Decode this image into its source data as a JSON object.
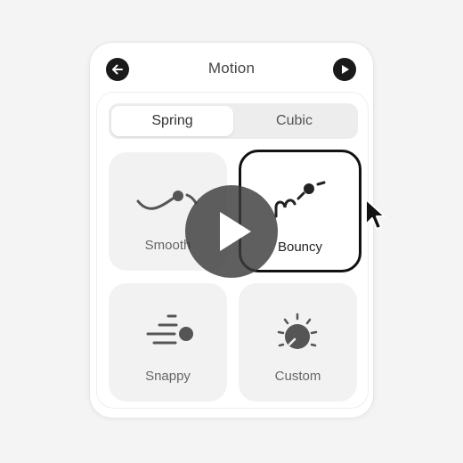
{
  "header": {
    "title": "Motion",
    "back_icon": "arrow-left-icon",
    "play_icon": "play-icon"
  },
  "segmented": {
    "options": [
      "Spring",
      "Cubic"
    ],
    "selected": "Spring"
  },
  "presets": [
    {
      "label": "Smooth",
      "icon": "smooth-curve-icon"
    },
    {
      "label": "Bouncy",
      "icon": "bouncy-curve-icon",
      "selected": true
    },
    {
      "label": "Snappy",
      "icon": "snappy-motion-icon"
    },
    {
      "label": "Custom",
      "icon": "custom-dial-icon"
    }
  ],
  "overlay": {
    "video_play_icon": "play-overlay-icon",
    "cursor_icon": "mouse-pointer-icon"
  },
  "colors": {
    "background": "#f4f4f4",
    "panel": "#ffffff",
    "tile": "#f2f2f2",
    "accent": "#111111"
  }
}
